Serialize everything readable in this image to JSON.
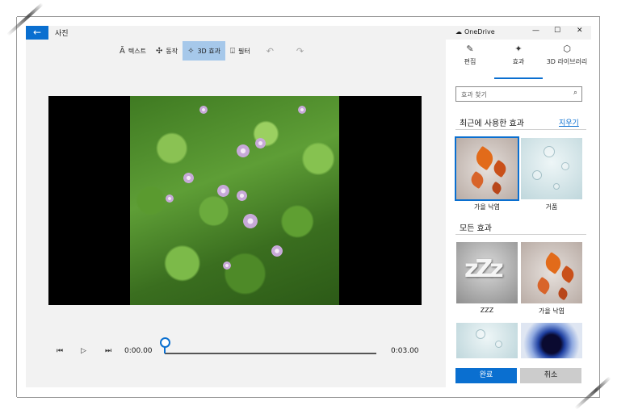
{
  "app": {
    "title": "사진",
    "back_icon": "arrow-left-icon"
  },
  "toolbar": {
    "items": [
      {
        "label": "텍스트",
        "icon": "text-icon"
      },
      {
        "label": "동작",
        "icon": "motion-icon"
      },
      {
        "label": "3D 효과",
        "icon": "3d-effects-icon",
        "active": true
      },
      {
        "label": "필터",
        "icon": "filter-icon"
      }
    ],
    "undo_icon": "undo-icon",
    "redo_icon": "redo-icon"
  },
  "player": {
    "current_time": "0:00.00",
    "end_time": "0:03.00",
    "position": 0.0
  },
  "panel": {
    "onedrive_label": "OneDrive",
    "tabs": [
      {
        "label": "편집",
        "icon": "pencil-icon"
      },
      {
        "label": "효과",
        "icon": "sparkle-icon",
        "selected": true
      },
      {
        "label": "3D 라이브러리",
        "icon": "cube-icon"
      }
    ],
    "search_placeholder": "효과 찾기",
    "recent_title": "최근에 사용한 효과",
    "clear_label": "지우기",
    "recent_effects": [
      {
        "label": "가을 낙엽",
        "selected": true
      },
      {
        "label": "거품"
      }
    ],
    "all_title": "모든 효과",
    "all_effects": [
      {
        "label": "ZZZ"
      },
      {
        "label": "가을 낙엽"
      },
      {
        "label": ""
      },
      {
        "label": ""
      }
    ],
    "done_label": "완료",
    "cancel_label": "취소"
  },
  "colors": {
    "accent": "#0a6fd0",
    "toolbar_active": "#a6c8ea"
  }
}
